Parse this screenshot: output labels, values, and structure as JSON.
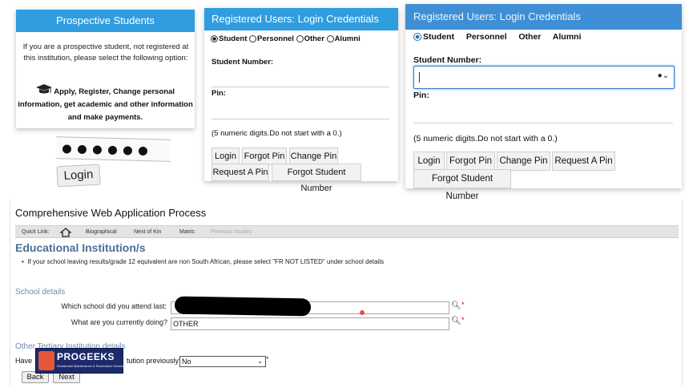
{
  "prospective": {
    "header": "Prospective Students",
    "intro": "If you are a prospective student, not registered at this institution, please select the following option:",
    "option": "Apply, Register, Change personal information, get academic and other information and make payments."
  },
  "password_demo": {
    "masked": "●●●●●●",
    "login_label": "Login"
  },
  "login_small": {
    "header": "Registered Users: Login Credentials",
    "roles": [
      "Student",
      "Personnel",
      "Other",
      "Alumni"
    ],
    "selected_role": "Student",
    "student_number_label": "Student Number:",
    "pin_label": "Pin:",
    "hint": "(5 numeric digits.Do not start with a 0.)",
    "buttons": [
      "Login",
      "Forgot Pin",
      "Change Pin",
      "Request A Pin",
      "Forgot Student Number"
    ]
  },
  "login_large": {
    "header": "Registered Users: Login Credentials",
    "roles": [
      "Student",
      "Personnel",
      "Other",
      "Alumni"
    ],
    "selected_role": "Student",
    "student_number_label": "Student Number:",
    "student_number_value": "",
    "pin_label": "Pin:",
    "hint": "(5 numeric digits.Do not start with a 0.)",
    "buttons": [
      "Login",
      "Forgot Pin",
      "Change Pin",
      "Request A Pin",
      "Forgot Student Number"
    ]
  },
  "application": {
    "title": "Comprehensive Web Application Process",
    "quick_link_label": "Quick Link:",
    "nav": [
      "Biographical",
      "Next of Kin",
      "Matric",
      "Previous studies"
    ],
    "section_title": "Educational Institution/s",
    "note": "If your school leaving results/grade 12 equivalent are non South African, please select \"FR NOT LISTED\" under school details",
    "school_details_heading": "School details",
    "school_question": "Which school did you attend last:",
    "school_value": "",
    "doing_question": "What are you currently doing?",
    "doing_value": "OTHER",
    "other_tertiary_heading": "Other Tertiary Institution details",
    "previous_question_visible": "Have",
    "previous_question_tail": "tution previously?",
    "previous_value": "No",
    "back_label": "Back",
    "next_label": "Next"
  },
  "watermark": {
    "brand": "PROGEEKS",
    "tagline": "Residential Maintenance & Renovation Services"
  },
  "colors": {
    "header_blue": "#2f9de0",
    "header_blue_large": "#3f8fd6",
    "title_blue": "#4a6f99",
    "required_red": "#cc0000"
  }
}
